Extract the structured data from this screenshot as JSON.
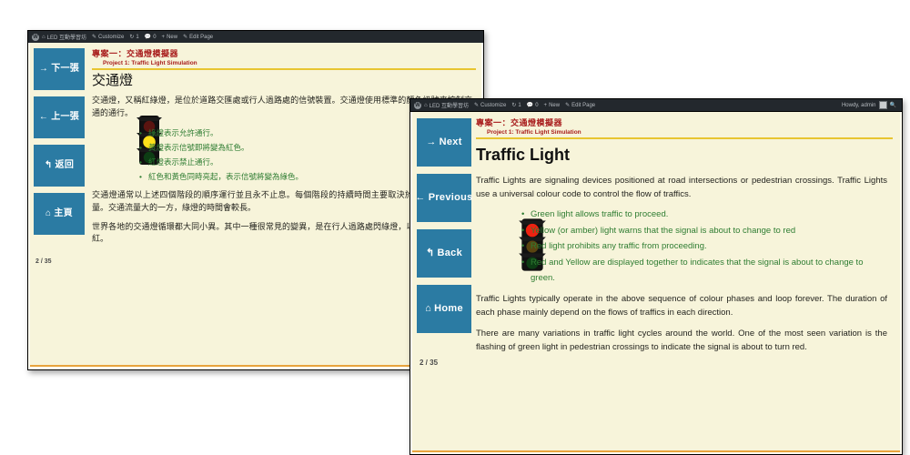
{
  "window_cn": {
    "adminbar": {
      "logo_icon": "wordpress-logo-icon",
      "site_icon": "home-icon",
      "site_name": "LED 互動學習坊",
      "customize_icon": "pencil-icon",
      "customize_label": "Customize",
      "updates_icon": "updates-icon",
      "updates_count": "1",
      "comments_icon": "comment-icon",
      "comments_count": "0",
      "new_icon": "plus-icon",
      "new_label": "New",
      "edit_icon": "pencil-icon",
      "edit_label": "Edit Page"
    },
    "nav": {
      "buttons": [
        {
          "arrow": "→",
          "label": "下一張",
          "name": "next"
        },
        {
          "arrow": "←",
          "label": "上一張",
          "name": "previous"
        },
        {
          "arrow": "↰",
          "label": "返回",
          "name": "back"
        },
        {
          "arrow": "⌂",
          "label": "主頁",
          "name": "home"
        }
      ],
      "page_indicator": "2 / 35"
    },
    "header": {
      "title_cn": "專案一：交通燈模擬器",
      "title_en": "Project 1: Traffic Light Simulation"
    },
    "article": {
      "heading": "交通燈",
      "paragraph_1": "交通燈，又稱紅綠燈，是位於道路交匯處或行人過路處的信號裝置。交通燈使用標準的顏色訊號來控制交通的通行。",
      "bullets": [
        "綠燈表示允許通行。",
        "黃燈表示信號即將變為紅色。",
        "紅燈表示禁止通行。",
        "紅色和黃色同時亮起，表示信號將變為綠色。"
      ],
      "paragraph_2": "交通燈通常以上述四個階段的順序運行並且永不止息。每個階段的持續時間主要取決於各方向的交通流量。交通流量大的一方，綠燈的時間會較長。",
      "paragraph_3": "世界各地的交通燈循環都大同小異。其中一種很常見的變異，是在行人過路處閃綠燈，以表示信號即將變紅。"
    },
    "traffic_light": {
      "lit_lamp": "yellow",
      "lamps": [
        "red",
        "yellow",
        "green"
      ]
    }
  },
  "window_en": {
    "adminbar": {
      "logo_icon": "wordpress-logo-icon",
      "site_icon": "home-icon",
      "site_name": "LED 互動學習坊",
      "customize_icon": "pencil-icon",
      "customize_label": "Customize",
      "updates_icon": "updates-icon",
      "updates_count": "1",
      "comments_icon": "comment-icon",
      "comments_count": "0",
      "new_icon": "plus-icon",
      "new_label": "New",
      "edit_icon": "pencil-icon",
      "edit_label": "Edit Page",
      "howdy": "Howdy, admin",
      "avatar_icon": "avatar-icon",
      "search_icon": "search-icon"
    },
    "nav": {
      "buttons": [
        {
          "arrow": "→",
          "label": "Next",
          "name": "next"
        },
        {
          "arrow": "←",
          "label": "Previous",
          "name": "previous"
        },
        {
          "arrow": "↰",
          "label": "Back",
          "name": "back"
        },
        {
          "arrow": "⌂",
          "label": "Home",
          "name": "home"
        }
      ],
      "page_indicator": "2 / 35"
    },
    "header": {
      "title_cn": "專案一：交通燈模擬器",
      "title_en": "Project 1: Traffic Light Simulation"
    },
    "article": {
      "heading": "Traffic Light",
      "paragraph_1": "Traffic Lights are signaling devices positioned at road intersections or pedestrian crossings. Traffic Lights use a universal colour code to control the flow of traffics.",
      "bullets": [
        "Green light allows traffic to proceed.",
        "Yellow (or amber) light warns that the signal is about to change to red",
        "Red light prohibits any traffic from proceeding.",
        "Red and Yellow are displayed together to indicates that the signal is about to change to green."
      ],
      "paragraph_2": "Traffic Lights typically operate in the above sequence of colour phases and loop forever. The duration of each phase mainly depend on the flows of traffics in each direction.",
      "paragraph_3": "There are many variations in traffic light cycles around the world. One of the most seen variation is the flashing of green light in pedestrian crossings to indicate the signal is about to turn red."
    },
    "traffic_light": {
      "lit_lamp": "red",
      "lamps": [
        "red",
        "yellow",
        "green"
      ]
    }
  },
  "theme": {
    "accent_blue": "#2b7ba3",
    "paper": "#f7f4da",
    "title_red": "#a81c1c",
    "rule_gold": "#e8c531",
    "bullet_green": "#2f7d32",
    "adminbar_bg": "#23282d",
    "frame_black": "#000000"
  }
}
